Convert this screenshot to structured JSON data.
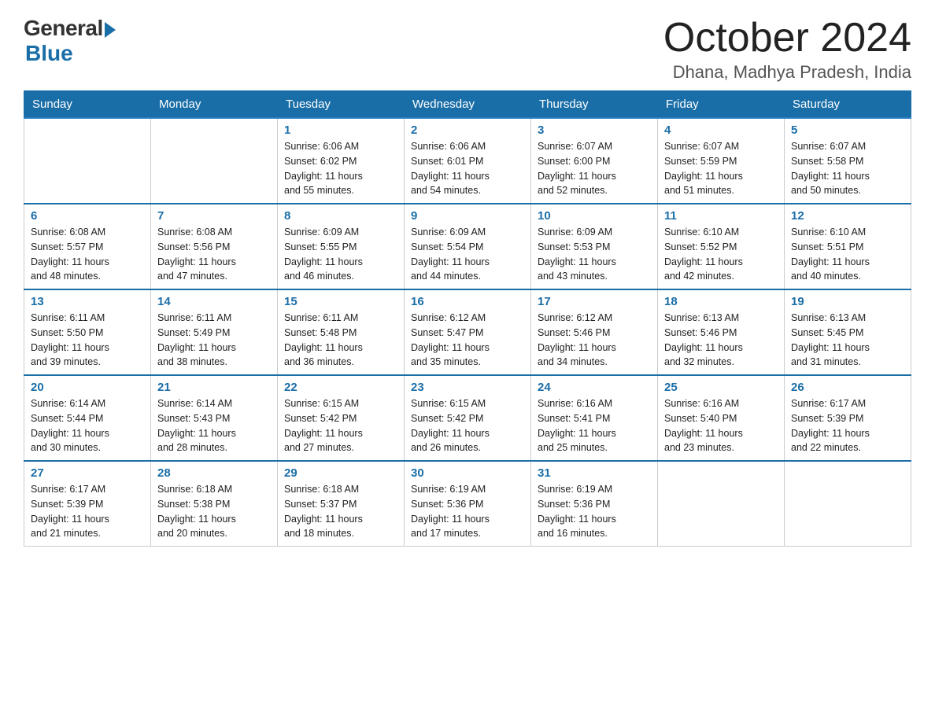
{
  "logo": {
    "general": "General",
    "blue": "Blue"
  },
  "title": "October 2024",
  "subtitle": "Dhana, Madhya Pradesh, India",
  "weekdays": [
    "Sunday",
    "Monday",
    "Tuesday",
    "Wednesday",
    "Thursday",
    "Friday",
    "Saturday"
  ],
  "rows": [
    [
      {
        "day": "",
        "info": ""
      },
      {
        "day": "",
        "info": ""
      },
      {
        "day": "1",
        "info": "Sunrise: 6:06 AM\nSunset: 6:02 PM\nDaylight: 11 hours\nand 55 minutes."
      },
      {
        "day": "2",
        "info": "Sunrise: 6:06 AM\nSunset: 6:01 PM\nDaylight: 11 hours\nand 54 minutes."
      },
      {
        "day": "3",
        "info": "Sunrise: 6:07 AM\nSunset: 6:00 PM\nDaylight: 11 hours\nand 52 minutes."
      },
      {
        "day": "4",
        "info": "Sunrise: 6:07 AM\nSunset: 5:59 PM\nDaylight: 11 hours\nand 51 minutes."
      },
      {
        "day": "5",
        "info": "Sunrise: 6:07 AM\nSunset: 5:58 PM\nDaylight: 11 hours\nand 50 minutes."
      }
    ],
    [
      {
        "day": "6",
        "info": "Sunrise: 6:08 AM\nSunset: 5:57 PM\nDaylight: 11 hours\nand 48 minutes."
      },
      {
        "day": "7",
        "info": "Sunrise: 6:08 AM\nSunset: 5:56 PM\nDaylight: 11 hours\nand 47 minutes."
      },
      {
        "day": "8",
        "info": "Sunrise: 6:09 AM\nSunset: 5:55 PM\nDaylight: 11 hours\nand 46 minutes."
      },
      {
        "day": "9",
        "info": "Sunrise: 6:09 AM\nSunset: 5:54 PM\nDaylight: 11 hours\nand 44 minutes."
      },
      {
        "day": "10",
        "info": "Sunrise: 6:09 AM\nSunset: 5:53 PM\nDaylight: 11 hours\nand 43 minutes."
      },
      {
        "day": "11",
        "info": "Sunrise: 6:10 AM\nSunset: 5:52 PM\nDaylight: 11 hours\nand 42 minutes."
      },
      {
        "day": "12",
        "info": "Sunrise: 6:10 AM\nSunset: 5:51 PM\nDaylight: 11 hours\nand 40 minutes."
      }
    ],
    [
      {
        "day": "13",
        "info": "Sunrise: 6:11 AM\nSunset: 5:50 PM\nDaylight: 11 hours\nand 39 minutes."
      },
      {
        "day": "14",
        "info": "Sunrise: 6:11 AM\nSunset: 5:49 PM\nDaylight: 11 hours\nand 38 minutes."
      },
      {
        "day": "15",
        "info": "Sunrise: 6:11 AM\nSunset: 5:48 PM\nDaylight: 11 hours\nand 36 minutes."
      },
      {
        "day": "16",
        "info": "Sunrise: 6:12 AM\nSunset: 5:47 PM\nDaylight: 11 hours\nand 35 minutes."
      },
      {
        "day": "17",
        "info": "Sunrise: 6:12 AM\nSunset: 5:46 PM\nDaylight: 11 hours\nand 34 minutes."
      },
      {
        "day": "18",
        "info": "Sunrise: 6:13 AM\nSunset: 5:46 PM\nDaylight: 11 hours\nand 32 minutes."
      },
      {
        "day": "19",
        "info": "Sunrise: 6:13 AM\nSunset: 5:45 PM\nDaylight: 11 hours\nand 31 minutes."
      }
    ],
    [
      {
        "day": "20",
        "info": "Sunrise: 6:14 AM\nSunset: 5:44 PM\nDaylight: 11 hours\nand 30 minutes."
      },
      {
        "day": "21",
        "info": "Sunrise: 6:14 AM\nSunset: 5:43 PM\nDaylight: 11 hours\nand 28 minutes."
      },
      {
        "day": "22",
        "info": "Sunrise: 6:15 AM\nSunset: 5:42 PM\nDaylight: 11 hours\nand 27 minutes."
      },
      {
        "day": "23",
        "info": "Sunrise: 6:15 AM\nSunset: 5:42 PM\nDaylight: 11 hours\nand 26 minutes."
      },
      {
        "day": "24",
        "info": "Sunrise: 6:16 AM\nSunset: 5:41 PM\nDaylight: 11 hours\nand 25 minutes."
      },
      {
        "day": "25",
        "info": "Sunrise: 6:16 AM\nSunset: 5:40 PM\nDaylight: 11 hours\nand 23 minutes."
      },
      {
        "day": "26",
        "info": "Sunrise: 6:17 AM\nSunset: 5:39 PM\nDaylight: 11 hours\nand 22 minutes."
      }
    ],
    [
      {
        "day": "27",
        "info": "Sunrise: 6:17 AM\nSunset: 5:39 PM\nDaylight: 11 hours\nand 21 minutes."
      },
      {
        "day": "28",
        "info": "Sunrise: 6:18 AM\nSunset: 5:38 PM\nDaylight: 11 hours\nand 20 minutes."
      },
      {
        "day": "29",
        "info": "Sunrise: 6:18 AM\nSunset: 5:37 PM\nDaylight: 11 hours\nand 18 minutes."
      },
      {
        "day": "30",
        "info": "Sunrise: 6:19 AM\nSunset: 5:36 PM\nDaylight: 11 hours\nand 17 minutes."
      },
      {
        "day": "31",
        "info": "Sunrise: 6:19 AM\nSunset: 5:36 PM\nDaylight: 11 hours\nand 16 minutes."
      },
      {
        "day": "",
        "info": ""
      },
      {
        "day": "",
        "info": ""
      }
    ]
  ]
}
